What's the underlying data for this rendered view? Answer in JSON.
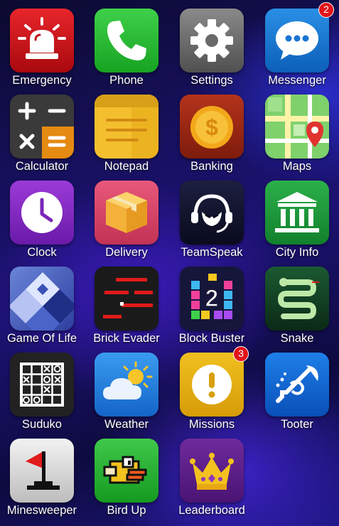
{
  "apps": [
    {
      "label": "Emergency",
      "icon": "siren-icon"
    },
    {
      "label": "Phone",
      "icon": "phone-icon"
    },
    {
      "label": "Settings",
      "icon": "gear-icon"
    },
    {
      "label": "Messenger",
      "icon": "chat-bubble-icon",
      "badge": "2"
    },
    {
      "label": "Calculator",
      "icon": "calculator-icon"
    },
    {
      "label": "Notepad",
      "icon": "notepad-icon"
    },
    {
      "label": "Banking",
      "icon": "dollar-coin-icon"
    },
    {
      "label": "Maps",
      "icon": "map-pin-icon"
    },
    {
      "label": "Clock",
      "icon": "clock-icon"
    },
    {
      "label": "Delivery",
      "icon": "package-icon"
    },
    {
      "label": "TeamSpeak",
      "icon": "headset-icon"
    },
    {
      "label": "City Info",
      "icon": "city-hall-icon"
    },
    {
      "label": "Game Of Life",
      "icon": "game-of-life-icon"
    },
    {
      "label": "Brick Evader",
      "icon": "brick-evader-icon"
    },
    {
      "label": "Block Buster",
      "icon": "block-buster-icon"
    },
    {
      "label": "Snake",
      "icon": "snake-icon"
    },
    {
      "label": "Suduko",
      "icon": "sudoku-grid-icon"
    },
    {
      "label": "Weather",
      "icon": "sun-cloud-icon"
    },
    {
      "label": "Missions",
      "icon": "exclamation-icon",
      "badge": "3"
    },
    {
      "label": "Tooter",
      "icon": "trumpet-icon"
    },
    {
      "label": "Minesweeper",
      "icon": "flag-icon"
    },
    {
      "label": "Bird Up",
      "icon": "flappy-bird-icon"
    },
    {
      "label": "Leaderboard",
      "icon": "crown-icon"
    }
  ],
  "colors": {
    "badge": "#e3141a",
    "label_text": "#ffffff",
    "wallpaper": "#1c1273"
  }
}
